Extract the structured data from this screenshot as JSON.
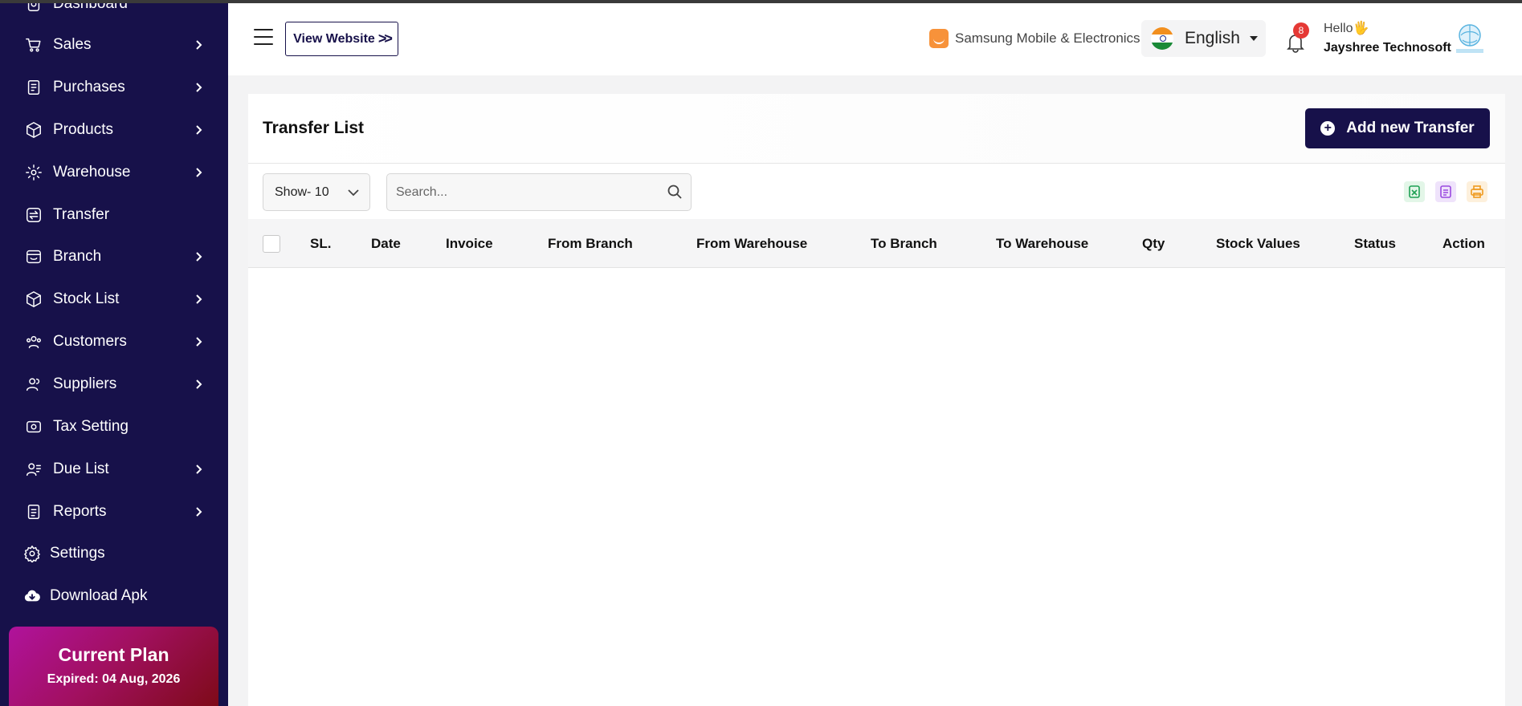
{
  "sidebar": {
    "items": [
      {
        "label": "Dashboard",
        "icon": "dashboard-icon",
        "chevron": false
      },
      {
        "label": "Sales",
        "icon": "cart-icon",
        "chevron": true
      },
      {
        "label": "Purchases",
        "icon": "receipt-icon",
        "chevron": true
      },
      {
        "label": "Products",
        "icon": "box-icon",
        "chevron": true
      },
      {
        "label": "Warehouse",
        "icon": "warehouse-icon",
        "chevron": true
      },
      {
        "label": "Transfer",
        "icon": "transfer-icon",
        "chevron": false
      },
      {
        "label": "Branch",
        "icon": "branch-icon",
        "chevron": true
      },
      {
        "label": "Stock List",
        "icon": "stock-icon",
        "chevron": true
      },
      {
        "label": "Customers",
        "icon": "customers-icon",
        "chevron": true
      },
      {
        "label": "Suppliers",
        "icon": "suppliers-icon",
        "chevron": true
      },
      {
        "label": "Tax Setting",
        "icon": "tax-icon",
        "chevron": false
      },
      {
        "label": "Due List",
        "icon": "due-list-icon",
        "chevron": true
      },
      {
        "label": "Reports",
        "icon": "reports-icon",
        "chevron": true
      },
      {
        "label": "Settings",
        "icon": "gear-icon",
        "chevron": false
      },
      {
        "label": "Download Apk",
        "icon": "cloud-download-icon",
        "chevron": false
      }
    ],
    "plan": {
      "title": "Current Plan",
      "expired": "Expired: 04 Aug, 2026"
    }
  },
  "header": {
    "view_website": "View Website",
    "shop_name": "Samsung Mobile & Electronics",
    "language": "English",
    "notifications": "8",
    "hello": "Hello🖐",
    "user": "Jayshree Technosoft"
  },
  "main": {
    "title": "Transfer List",
    "add_button": "Add new Transfer",
    "show_select": "Show- 10",
    "search_placeholder": "Search...",
    "columns": [
      "SL.",
      "Date",
      "Invoice",
      "From Branch",
      "From Warehouse",
      "To Branch",
      "To Warehouse",
      "Qty",
      "Stock Values",
      "Status",
      "Action"
    ],
    "rows": []
  },
  "colors": {
    "sidebar_bg": "#17114a",
    "primary": "#17114a",
    "plan_start": "#b0129c",
    "plan_end": "#7c0a14"
  }
}
